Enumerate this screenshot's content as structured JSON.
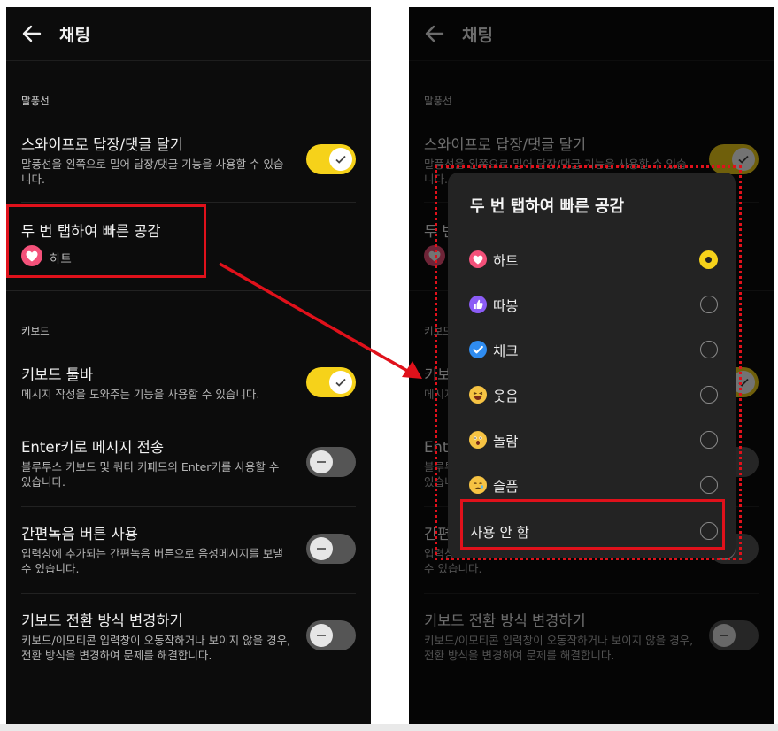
{
  "header": {
    "title": "채팅"
  },
  "sections": {
    "balloon": "말풍선",
    "keyboard": "키보드"
  },
  "settings": {
    "swipe": {
      "title": "스와이프로 답장/댓글 달기",
      "desc": "말풍선을 왼쪽으로 밀어 답장/댓글 기능을 사용할 수 있습니다.",
      "enabled": true
    },
    "double_tap": {
      "title": "두 번 탭하여 빠른 공감",
      "value": "하트"
    },
    "toolbar": {
      "title": "키보드 툴바",
      "desc": "메시지 작성을 도와주는 기능을 사용할 수 있습니다.",
      "enabled": true
    },
    "enter_send": {
      "title": "Enter키로 메시지 전송",
      "desc": "블루투스 키보드 및 쿼티 키패드의 Enter키를 사용할 수 있습니다.",
      "enabled": false
    },
    "voice": {
      "title": "간편녹음 버튼 사용",
      "desc": "입력창에 추가되는 간편녹음 버튼으로 음성메시지를 보낼 수 있습니다.",
      "enabled": false
    },
    "switch_mode": {
      "title": "키보드 전환 방식 변경하기",
      "desc": "키보드/이모티콘 입력창이 오동작하거나 보이지 않을 경우, 전환 방식을 변경하여 문제를 해결합니다.",
      "enabled": false
    }
  },
  "dialog": {
    "title": "두 번 탭하여 빠른 공감",
    "options": [
      {
        "label": "하트",
        "icon": "heart-icon",
        "color": "#f4517a",
        "selected": true
      },
      {
        "label": "따봉",
        "icon": "thumbs-up-icon",
        "color": "#8b5cf6",
        "selected": false
      },
      {
        "label": "체크",
        "icon": "check-icon",
        "color": "#2f8cf0",
        "selected": false
      },
      {
        "label": "웃음",
        "icon": "laughing-emoji-icon",
        "color": "#f6c343",
        "selected": false
      },
      {
        "label": "놀람",
        "icon": "surprised-emoji-icon",
        "color": "#f6c343",
        "selected": false
      },
      {
        "label": "슬픔",
        "icon": "sad-emoji-icon",
        "color": "#f6c343",
        "selected": false
      },
      {
        "label": "사용 안 함",
        "icon": "",
        "selected": false
      }
    ]
  },
  "colors": {
    "accent": "#f6d21a",
    "annotation": "#e0111b",
    "background": "#0c0c0c"
  }
}
